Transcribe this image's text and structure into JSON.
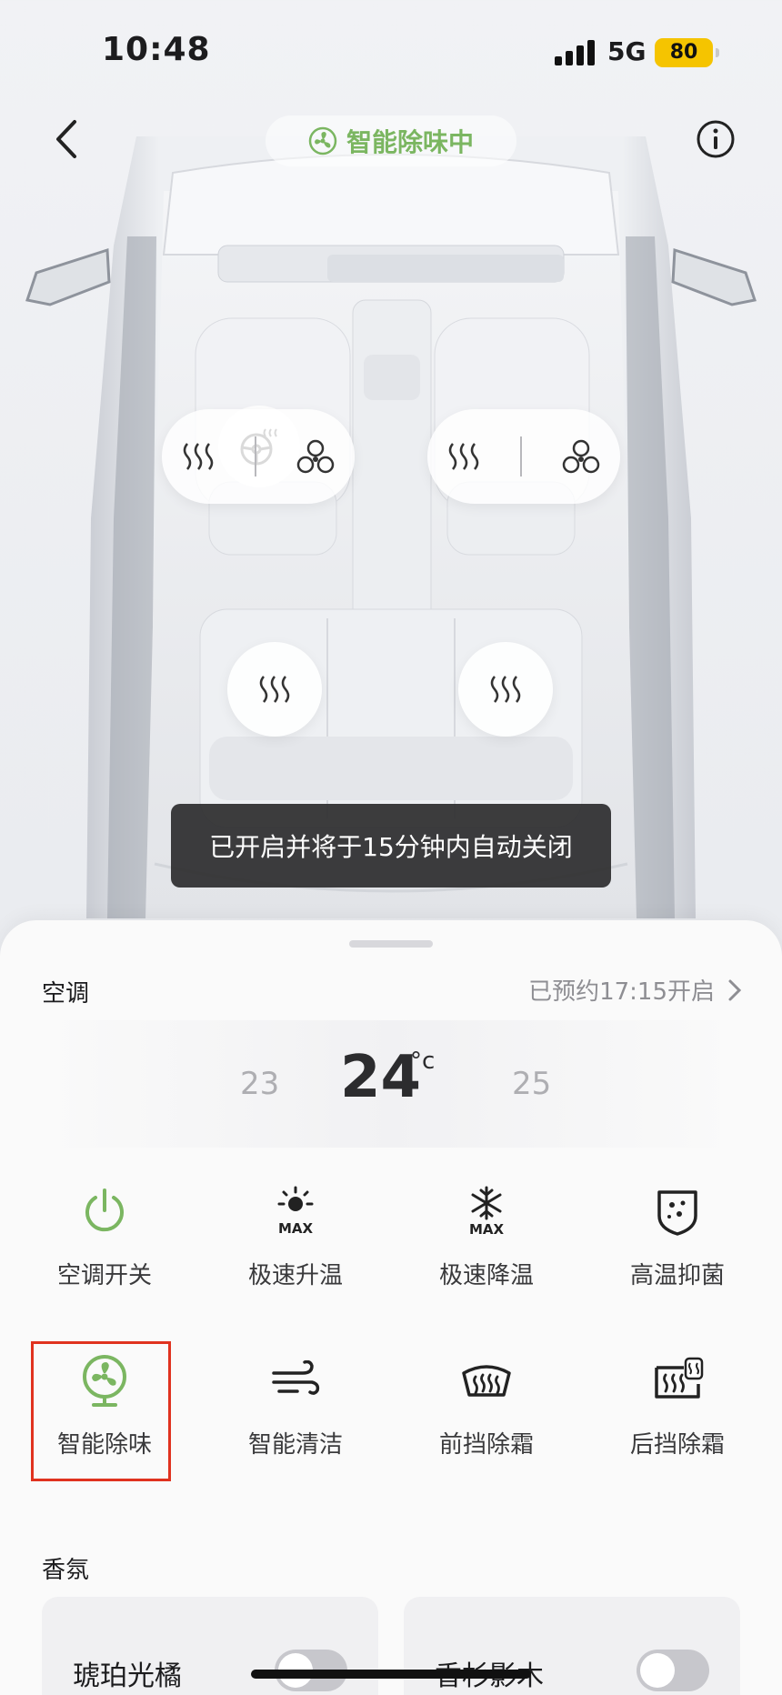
{
  "status_bar": {
    "time": "10:48",
    "network": "5G",
    "battery": "80"
  },
  "header": {
    "mode_label": "智能除味中"
  },
  "toast": "已开启并将于15分钟内自动关闭",
  "climate": {
    "title": "空调",
    "schedule": "已预约17:15开启",
    "temp_prev": "23",
    "temp_current": "24",
    "temp_unit": "°c",
    "temp_next": "25"
  },
  "functions": [
    {
      "label": "空调开关",
      "icon": "power-icon"
    },
    {
      "label": "极速升温",
      "icon": "sun-max-icon"
    },
    {
      "label": "极速降温",
      "icon": "snowflake-max-icon"
    },
    {
      "label": "高温抑菌",
      "icon": "shield-icon"
    },
    {
      "label": "智能除味",
      "icon": "fan-icon",
      "active": true
    },
    {
      "label": "智能清洁",
      "icon": "wind-icon"
    },
    {
      "label": "前挡除霜",
      "icon": "front-defrost-icon"
    },
    {
      "label": "后挡除霜",
      "icon": "rear-defrost-icon"
    }
  ],
  "fragrance": {
    "title": "香氛",
    "items": [
      {
        "name": "琥珀光橘",
        "on": false
      },
      {
        "name": "香杉影木",
        "on": false
      }
    ]
  },
  "colors": {
    "accent_green": "#7bb661",
    "highlight_red": "#e0321f"
  }
}
